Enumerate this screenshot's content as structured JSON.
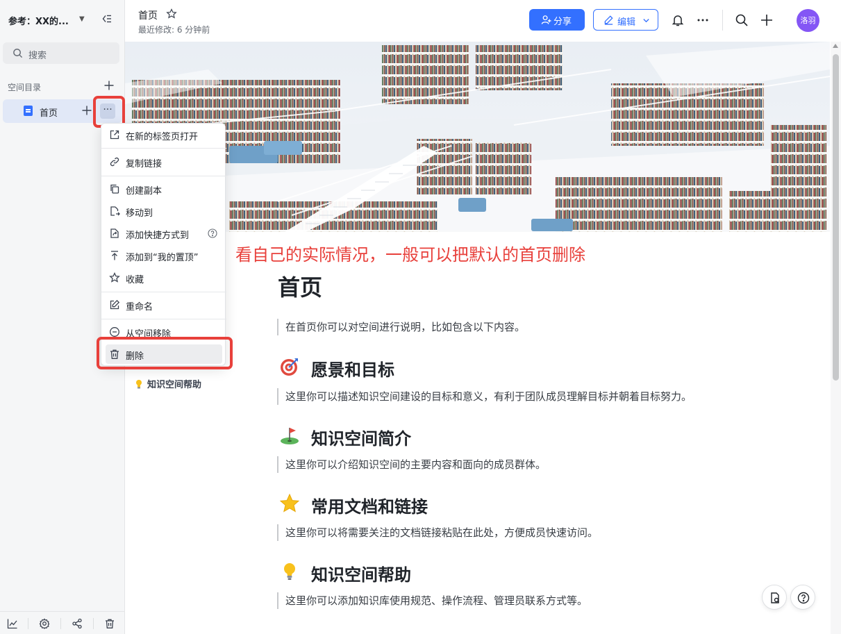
{
  "sidebar": {
    "space_title": "参考：XX的...",
    "search_placeholder": "搜索",
    "section_label": "空间目录",
    "items": [
      {
        "label": "首页"
      }
    ]
  },
  "context_menu": {
    "items": [
      {
        "label": "在新的标签页打开",
        "icon": "open-new-tab-icon"
      },
      {
        "label": "复制链接",
        "icon": "link-icon"
      },
      {
        "label": "创建副本",
        "icon": "copy-icon"
      },
      {
        "label": "移动到",
        "icon": "move-icon"
      },
      {
        "label": "添加快捷方式到",
        "icon": "shortcut-icon"
      },
      {
        "label": "添加到“我的置顶”",
        "icon": "pin-top-icon"
      },
      {
        "label": "收藏",
        "icon": "star-icon"
      },
      {
        "label": "重命名",
        "icon": "rename-icon"
      },
      {
        "label": "从空间移除",
        "icon": "remove-circle-icon"
      },
      {
        "label": "删除",
        "icon": "trash-icon"
      }
    ]
  },
  "topbar": {
    "doc_title": "首页",
    "last_modified": "最近修改: 6 分钟前",
    "share_label": "分享",
    "edit_label": "编辑",
    "avatar_text": "洛羽"
  },
  "annotation": "看自己的实际情况，一般可以把默认的首页删除",
  "toc": {
    "item": "知识空间帮助"
  },
  "document": {
    "title": "首页",
    "intro": "在首页你可以对空间进行说明，比如包含以下内容。",
    "sections": [
      {
        "heading": "愿景和目标",
        "text": "这里你可以描述知识空间建设的目标和意义，有利于团队成员理解目标并朝着目标努力。",
        "icon": "target-icon"
      },
      {
        "heading": "知识空间简介",
        "text": "这里你可以介绍知识空间的主要内容和面向的成员群体。",
        "icon": "golf-flag-icon"
      },
      {
        "heading": "常用文档和链接",
        "text": "这里你可以将需要关注的文档链接粘贴在此处，方便成员快速访问。",
        "icon": "star-emoji-icon"
      },
      {
        "heading": "知识空间帮助",
        "text": "这里你可以添加知识库使用规范、操作流程、管理员联系方式等。",
        "icon": "light-bulb-icon"
      }
    ]
  },
  "colors": {
    "accent": "#3370ff",
    "annotation_red": "#e8403b",
    "avatar": "#8456f5"
  }
}
